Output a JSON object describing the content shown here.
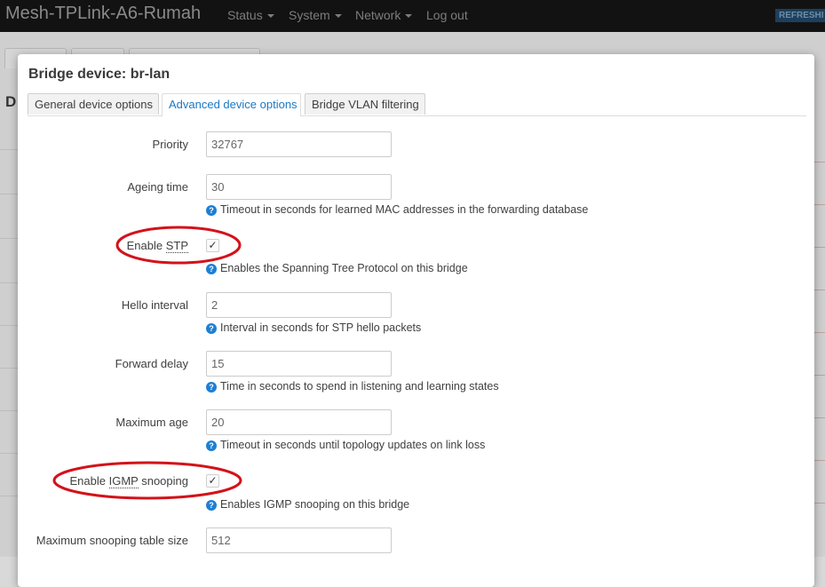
{
  "navbar": {
    "brand": "Mesh-TPLink-A6-Rumah",
    "menus": [
      {
        "label": "Status",
        "has_caret": true
      },
      {
        "label": "System",
        "has_caret": true
      },
      {
        "label": "Network",
        "has_caret": true
      },
      {
        "label": "Log out",
        "has_caret": false
      }
    ],
    "refresh": "REFRESHI"
  },
  "background": {
    "letter_d": "D"
  },
  "modal": {
    "title": "Bridge device: br-lan",
    "tabs": [
      {
        "label": "General device options",
        "active": false
      },
      {
        "label": "Advanced device options",
        "active": true
      },
      {
        "label": "Bridge VLAN filtering",
        "active": false
      }
    ],
    "fields": {
      "priority": {
        "label": "Priority",
        "value": "32767"
      },
      "ageing_time": {
        "label": "Ageing time",
        "value": "30",
        "help": "Timeout in seconds for learned MAC addresses in the forwarding database"
      },
      "enable_stp": {
        "label_prefix": "Enable ",
        "label_abbr": "STP",
        "label_suffix": "",
        "checked": true,
        "help": "Enables the Spanning Tree Protocol on this bridge"
      },
      "hello_interval": {
        "label": "Hello interval",
        "value": "2",
        "help": "Interval in seconds for STP hello packets"
      },
      "forward_delay": {
        "label": "Forward delay",
        "value": "15",
        "help": "Time in seconds to spend in listening and learning states"
      },
      "maximum_age": {
        "label": "Maximum age",
        "value": "20",
        "help": "Timeout in seconds until topology updates on link loss"
      },
      "enable_igmp": {
        "label_prefix": "Enable ",
        "label_abbr": "IGMP",
        "label_suffix": " snooping",
        "checked": true,
        "help": "Enables IGMP snooping on this bridge"
      },
      "max_snooping_table": {
        "label": "Maximum snooping table size",
        "value": "512"
      }
    }
  },
  "colors": {
    "accent": "#1b79c3",
    "help_icon": "#1e7fd4",
    "annotation_ring": "#d3121a"
  },
  "icons": {
    "help": "question-circle-icon",
    "check": "checkmark-icon",
    "caret": "caret-down-icon"
  }
}
